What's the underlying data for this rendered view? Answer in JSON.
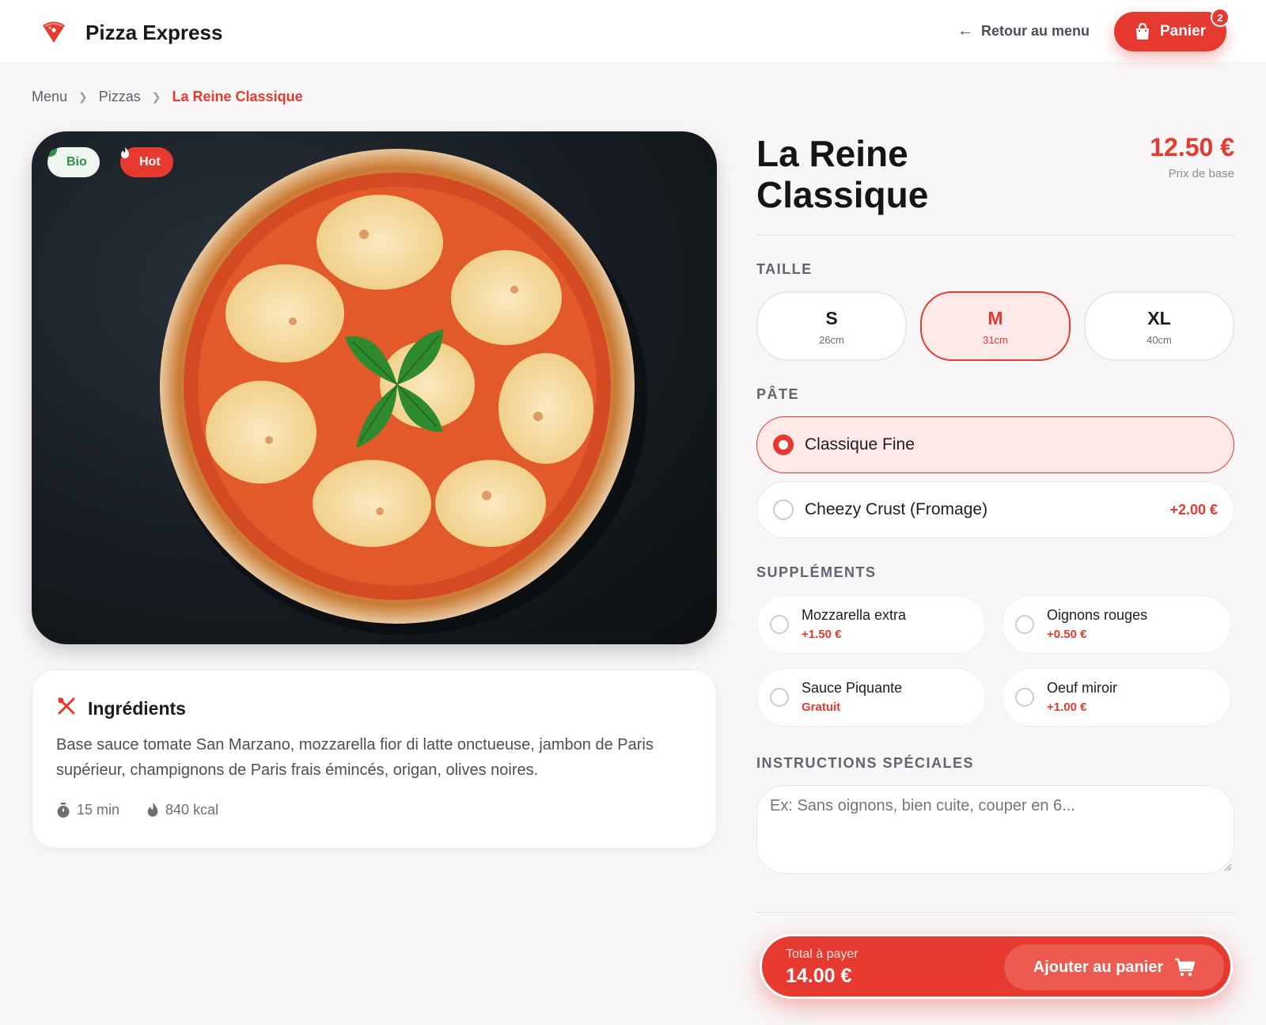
{
  "header": {
    "brand": "Pizza Express",
    "back_label": "Retour au menu",
    "cart_label": "Panier",
    "cart_count": "2"
  },
  "breadcrumb": [
    "Menu",
    "Pizzas",
    "La Reine Classique"
  ],
  "hero": {
    "tags": [
      {
        "label": "Bio",
        "icon": "leaf-icon"
      },
      {
        "label": "Hot",
        "icon": "flame-icon"
      }
    ]
  },
  "ingredients": {
    "title": "Ingrédients",
    "text": "Base sauce tomate San Marzano, mozzarella fior di latte onctueuse, jambon de Paris supérieur, champignons de Paris frais émincés, origan, olives noires.",
    "time": "15 min",
    "calories": "840 kcal"
  },
  "product": {
    "title": "La Reine Classique",
    "price": "12.50 €",
    "price_label": "Prix de base"
  },
  "sections": {
    "size": "TAILLE",
    "crust": "PÂTE",
    "supplements": "SUPPLÉMENTS",
    "instructions": "INSTRUCTIONS SPÉCIALES"
  },
  "sizes": [
    {
      "label": "S",
      "desc": "26cm",
      "selected": false
    },
    {
      "label": "M",
      "desc": "31cm",
      "selected": true
    },
    {
      "label": "XL",
      "desc": "40cm",
      "selected": false
    }
  ],
  "crusts": [
    {
      "label": "Classique Fine",
      "extra": "",
      "selected": true
    },
    {
      "label": "Cheezy Crust (Fromage)",
      "extra": "+2.00 €",
      "selected": false
    }
  ],
  "supplements": [
    {
      "label": "Mozzarella extra",
      "price": "+1.50 €"
    },
    {
      "label": "Oignons rouges",
      "price": "+0.50 €"
    },
    {
      "label": "Sauce Piquante",
      "price": "Gratuit"
    },
    {
      "label": "Oeuf miroir",
      "price": "+1.00 €"
    }
  ],
  "instructions_placeholder": "Ex: Sans oignons, bien cuite, couper en 6...",
  "footer": {
    "total_label": "Total à payer",
    "total_value": "14.00 €",
    "add_label": "Ajouter au panier"
  },
  "colors": {
    "accent": "#e6392f",
    "accent_light": "#fde9e8",
    "bio_green": "#2f8f47"
  }
}
